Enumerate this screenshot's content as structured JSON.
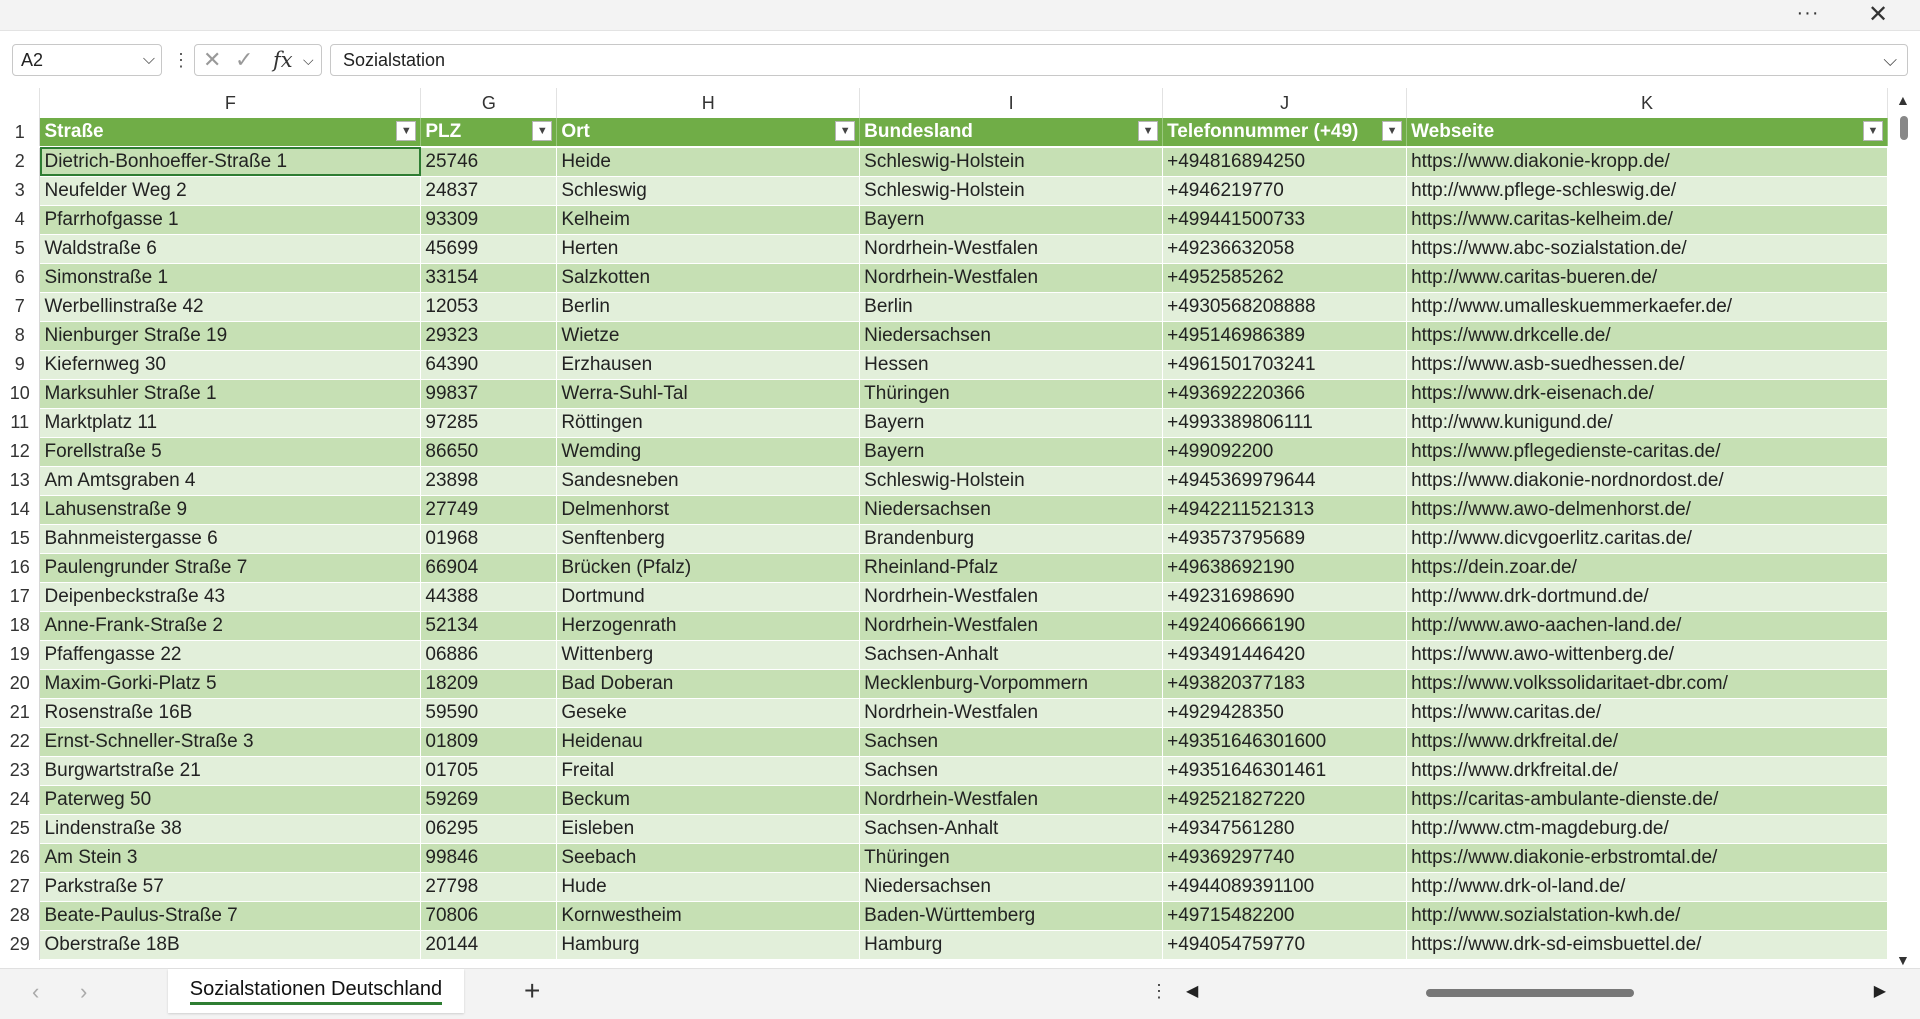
{
  "window": {
    "more_label": "···",
    "close_label": "✕"
  },
  "formula_bar": {
    "name_box": "A2",
    "menu_dots": "⋮",
    "cancel_icon": "✕",
    "enter_icon": "✓",
    "fx_label": "fx",
    "formula_value": "Sozialstation"
  },
  "columns": [
    "F",
    "G",
    "H",
    "I",
    "J",
    "K"
  ],
  "headers": [
    "Straße",
    "PLZ",
    "Ort",
    "Bundesland",
    "Telefonnummer (+49)",
    "Webseite"
  ],
  "rows": [
    {
      "n": "2",
      "c": [
        "Dietrich-Bonhoeffer-Straße 1",
        "25746",
        "Heide",
        "Schleswig-Holstein",
        "+494816894250",
        "https://www.diakonie-kropp.de/"
      ]
    },
    {
      "n": "3",
      "c": [
        "Neufelder Weg 2",
        "24837",
        "Schleswig",
        "Schleswig-Holstein",
        "+4946219770",
        "http://www.pflege-schleswig.de/"
      ]
    },
    {
      "n": "4",
      "c": [
        "Pfarrhofgasse 1",
        "93309",
        "Kelheim",
        "Bayern",
        "+499441500733",
        "https://www.caritas-kelheim.de/"
      ]
    },
    {
      "n": "5",
      "c": [
        "Waldstraße 6",
        "45699",
        "Herten",
        "Nordrhein-Westfalen",
        "+49236632058",
        "https://www.abc-sozialstation.de/"
      ]
    },
    {
      "n": "6",
      "c": [
        "Simonstraße 1",
        "33154",
        "Salzkotten",
        "Nordrhein-Westfalen",
        "+4952585262",
        "http://www.caritas-bueren.de/"
      ]
    },
    {
      "n": "7",
      "c": [
        "Werbellinstraße 42",
        "12053",
        "Berlin",
        "Berlin",
        "+4930568208888",
        "http://www.umalleskuemmerkaefer.de/"
      ]
    },
    {
      "n": "8",
      "c": [
        "Nienburger Straße 19",
        "29323",
        "Wietze",
        "Niedersachsen",
        "+495146986389",
        "https://www.drkcelle.de/"
      ]
    },
    {
      "n": "9",
      "c": [
        "Kiefernweg 30",
        "64390",
        "Erzhausen",
        "Hessen",
        "+4961501703241",
        "https://www.asb-suedhessen.de/"
      ]
    },
    {
      "n": "10",
      "c": [
        "Marksuhler Straße 1",
        "99837",
        "Werra-Suhl-Tal",
        "Thüringen",
        "+493692220366",
        "https://www.drk-eisenach.de/"
      ]
    },
    {
      "n": "11",
      "c": [
        "Marktplatz 11",
        "97285",
        "Röttingen",
        "Bayern",
        "+4993389806111",
        "http://www.kunigund.de/"
      ]
    },
    {
      "n": "12",
      "c": [
        "Forellstraße 5",
        "86650",
        "Wemding",
        "Bayern",
        "+499092200",
        "https://www.pflegedienste-caritas.de/"
      ]
    },
    {
      "n": "13",
      "c": [
        "Am Amtsgraben 4",
        "23898",
        "Sandesneben",
        "Schleswig-Holstein",
        "+4945369979644",
        "https://www.diakonie-nordnordost.de/"
      ]
    },
    {
      "n": "14",
      "c": [
        "Lahusenstraße 9",
        "27749",
        "Delmenhorst",
        "Niedersachsen",
        "+4942211521313",
        "https://www.awo-delmenhorst.de/"
      ]
    },
    {
      "n": "15",
      "c": [
        "Bahnmeistergasse 6",
        "01968",
        "Senftenberg",
        "Brandenburg",
        "+493573795689",
        "http://www.dicvgoerlitz.caritas.de/"
      ]
    },
    {
      "n": "16",
      "c": [
        "Paulengrunder Straße 7",
        "66904",
        "Brücken (Pfalz)",
        "Rheinland-Pfalz",
        "+49638692190",
        "https://dein.zoar.de/"
      ]
    },
    {
      "n": "17",
      "c": [
        "Deipenbeckstraße 43",
        "44388",
        "Dortmund",
        "Nordrhein-Westfalen",
        "+49231698690",
        "http://www.drk-dortmund.de/"
      ]
    },
    {
      "n": "18",
      "c": [
        "Anne-Frank-Straße 2",
        "52134",
        "Herzogenrath",
        "Nordrhein-Westfalen",
        "+492406666190",
        "http://www.awo-aachen-land.de/"
      ]
    },
    {
      "n": "19",
      "c": [
        "Pfaffengasse 22",
        "06886",
        "Wittenberg",
        "Sachsen-Anhalt",
        "+493491446420",
        "https://www.awo-wittenberg.de/"
      ]
    },
    {
      "n": "20",
      "c": [
        "Maxim-Gorki-Platz 5",
        "18209",
        "Bad Doberan",
        "Mecklenburg-Vorpommern",
        "+493820377183",
        "https://www.volkssolidaritaet-dbr.com/"
      ]
    },
    {
      "n": "21",
      "c": [
        "Rosenstraße 16B",
        "59590",
        "Geseke",
        "Nordrhein-Westfalen",
        "+4929428350",
        "https://www.caritas.de/"
      ]
    },
    {
      "n": "22",
      "c": [
        "Ernst-Schneller-Straße 3",
        "01809",
        "Heidenau",
        "Sachsen",
        "+49351646301600",
        "https://www.drkfreital.de/"
      ]
    },
    {
      "n": "23",
      "c": [
        "Burgwartstraße 21",
        "01705",
        "Freital",
        "Sachsen",
        "+49351646301461",
        "https://www.drkfreital.de/"
      ]
    },
    {
      "n": "24",
      "c": [
        "Paterweg 50",
        "59269",
        "Beckum",
        "Nordrhein-Westfalen",
        "+492521827220",
        "https://caritas-ambulante-dienste.de/"
      ]
    },
    {
      "n": "25",
      "c": [
        "Lindenstraße 38",
        "06295",
        "Eisleben",
        "Sachsen-Anhalt",
        "+49347561280",
        "http://www.ctm-magdeburg.de/"
      ]
    },
    {
      "n": "26",
      "c": [
        "Am Stein 3",
        "99846",
        "Seebach",
        "Thüringen",
        "+49369297740",
        "https://www.diakonie-erbstromtal.de/"
      ]
    },
    {
      "n": "27",
      "c": [
        "Parkstraße 57",
        "27798",
        "Hude",
        "Niedersachsen",
        "+4944089391100",
        "http://www.drk-ol-land.de/"
      ]
    },
    {
      "n": "28",
      "c": [
        "Beate-Paulus-Straße 7",
        "70806",
        "Kornwestheim",
        "Baden-Württemberg",
        "+49715482200",
        "http://www.sozialstation-kwh.de/"
      ]
    },
    {
      "n": "29",
      "c": [
        "Oberstraße 18B",
        "20144",
        "Hamburg",
        "Hamburg",
        "+494054759770",
        "https://www.drk-sd-eimsbuettel.de/"
      ]
    }
  ],
  "sheet_tab": "Sozialstationen Deutschland",
  "add_sheet": "+",
  "colors": {
    "header_green": "#70ad47",
    "band_dark": "#c6e0b4",
    "band_light": "#e2efda",
    "accent": "#2e7d32"
  }
}
